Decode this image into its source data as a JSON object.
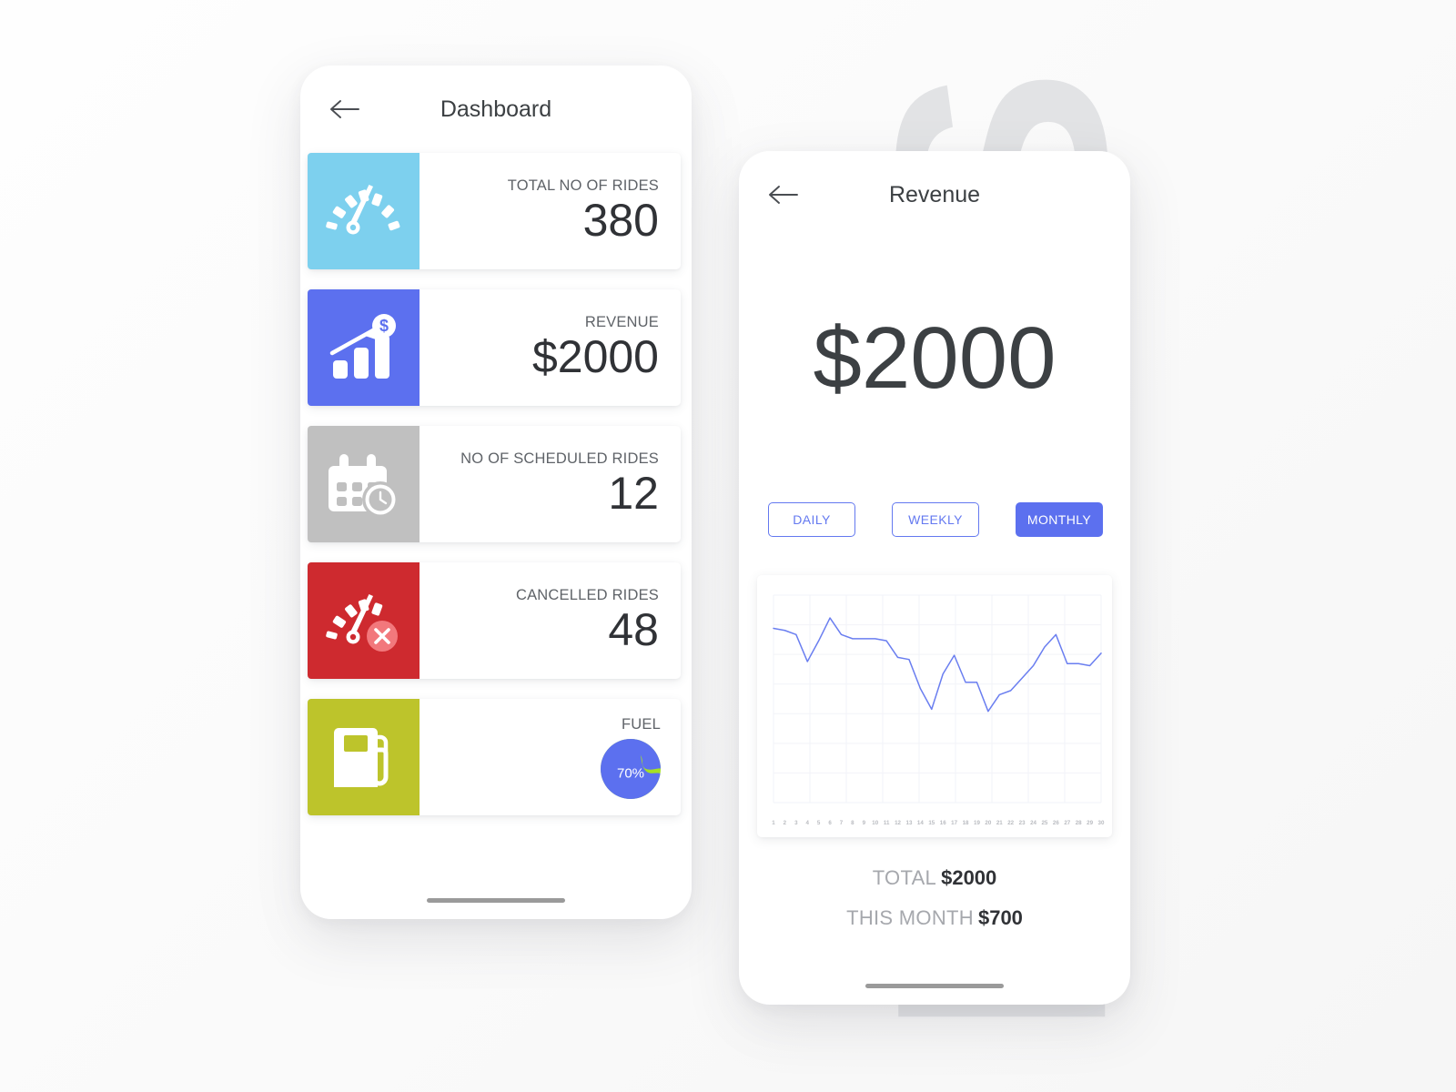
{
  "watermark": {
    "text": "RIDES",
    "color": "#e2e3e5"
  },
  "dashboard": {
    "nav": {
      "title": "Dashboard",
      "back_icon": "arrow-left-icon"
    },
    "cards": [
      {
        "label": "TOTAL NO OF RIDES",
        "value": "380",
        "icon": "speedometer-icon",
        "color": "#7dd0ee"
      },
      {
        "label": "REVENUE",
        "value": "$2000",
        "icon": "bar-chart-dollar-icon",
        "color": "#5c70ef"
      },
      {
        "label": "NO OF SCHEDULED RIDES",
        "value": "12",
        "icon": "calendar-clock-icon",
        "color": "#c0c0c0"
      },
      {
        "label": "CANCELLED RIDES",
        "value": "48",
        "icon": "speedometer-cancel-icon",
        "color": "#ce2a2f"
      },
      {
        "label": "FUEL",
        "value": "70%",
        "icon": "fuel-pump-icon",
        "color": "#bdc42b",
        "pie": {
          "percent": 70,
          "fill_color": "#5c70ef",
          "empty_color": "#a6e023"
        }
      }
    ]
  },
  "revenue": {
    "nav": {
      "title": "Revenue",
      "back_icon": "arrow-left-icon"
    },
    "amount": "$2000",
    "periods": [
      {
        "label": "DAILY",
        "active": false
      },
      {
        "label": "WEEKLY",
        "active": false
      },
      {
        "label": "MONTHLY",
        "active": true
      }
    ],
    "totals": [
      {
        "label": "TOTAL",
        "value": "$2000"
      },
      {
        "label": "THIS MONTH",
        "value": "$700"
      }
    ]
  },
  "chart_data": {
    "type": "line",
    "title": "",
    "xlabel": "",
    "ylabel": "",
    "line_color": "#6a7ef0",
    "grid": true,
    "legend": "none",
    "xlim": [
      1,
      30
    ],
    "ylim": [
      0,
      100
    ],
    "categories": [
      "1",
      "2",
      "3",
      "4",
      "5",
      "6",
      "7",
      "8",
      "9",
      "10",
      "11",
      "12",
      "13",
      "14",
      "15",
      "16",
      "17",
      "18",
      "19",
      "20",
      "21",
      "22",
      "23",
      "24",
      "25",
      "26",
      "27",
      "28",
      "29",
      "30"
    ],
    "series": [
      {
        "name": "Revenue",
        "values": [
          84,
          83,
          81,
          68,
          78,
          89,
          81,
          79,
          79,
          79,
          78,
          70,
          69,
          55,
          45,
          62,
          71,
          58,
          58,
          44,
          52,
          54,
          60,
          66,
          75,
          81,
          67,
          67,
          66,
          72
        ]
      }
    ]
  }
}
